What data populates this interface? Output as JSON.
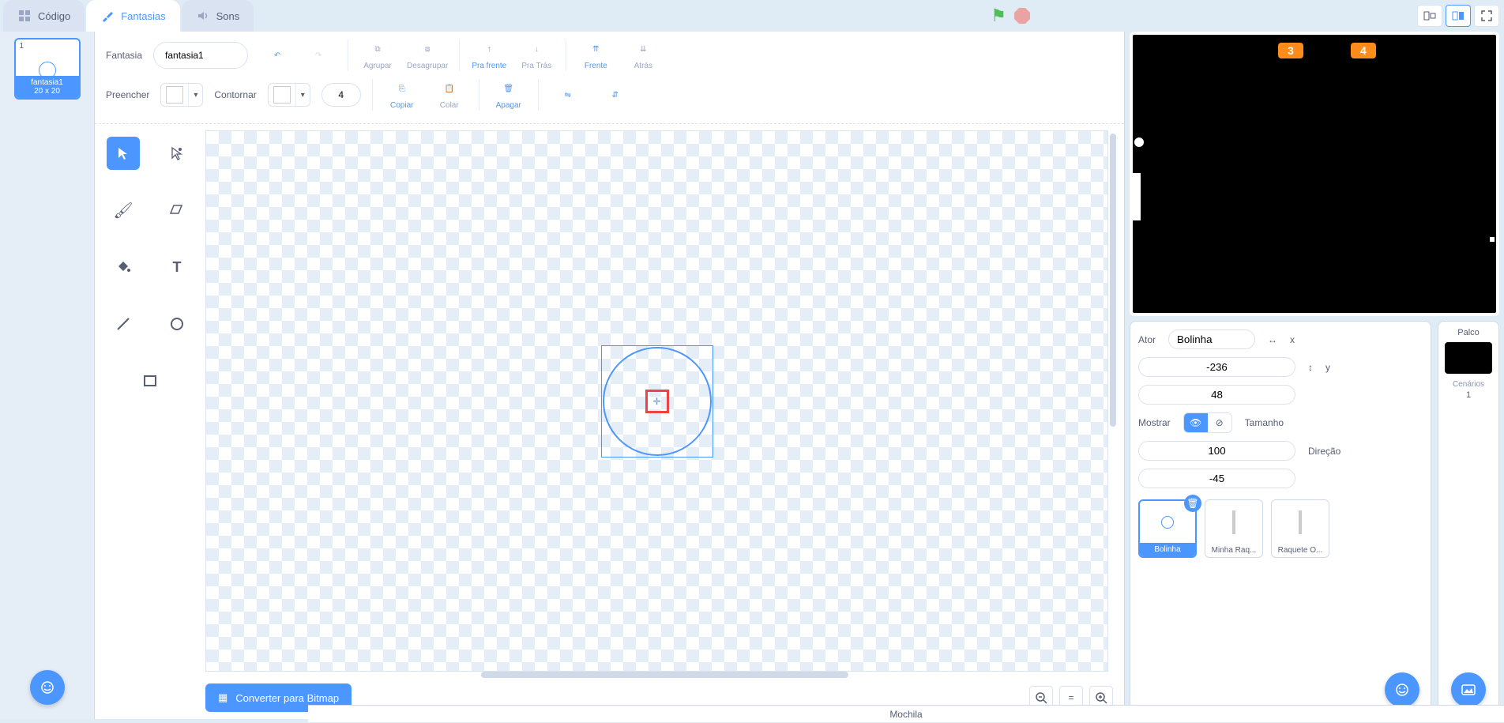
{
  "tabs": {
    "code": "Código",
    "costumes": "Fantasias",
    "sounds": "Sons"
  },
  "costume_list": {
    "index": "1",
    "name": "fantasia1",
    "size": "20 x 20"
  },
  "editor": {
    "costume_label": "Fantasia",
    "costume_name": "fantasia1",
    "group": "Agrupar",
    "ungroup": "Desagrupar",
    "forward": "Pra frente",
    "backward": "Pra Trás",
    "front": "Frente",
    "back": "Atrás",
    "fill": "Preencher",
    "outline": "Contornar",
    "outline_width": "4",
    "copy": "Copiar",
    "paste": "Colar",
    "delete": "Apagar",
    "convert": "Converter para Bitmap"
  },
  "stage_monitors": {
    "score1": "3",
    "score2": "4"
  },
  "sprite_panel": {
    "actor_label": "Ator",
    "actor_name": "Bolinha",
    "x_label": "x",
    "x_value": "-236",
    "y_label": "y",
    "y_value": "48",
    "show_label": "Mostrar",
    "size_label": "Tamanho",
    "size_value": "100",
    "direction_label": "Direção",
    "direction_value": "-45"
  },
  "sprites": [
    {
      "name": "Bolinha",
      "selected": true
    },
    {
      "name": "Minha Raq...",
      "selected": false
    },
    {
      "name": "Raquete O...",
      "selected": false
    }
  ],
  "stage_col": {
    "title": "Palco",
    "backdrops_label": "Cenários",
    "backdrops_count": "1"
  },
  "backpack": "Mochila"
}
